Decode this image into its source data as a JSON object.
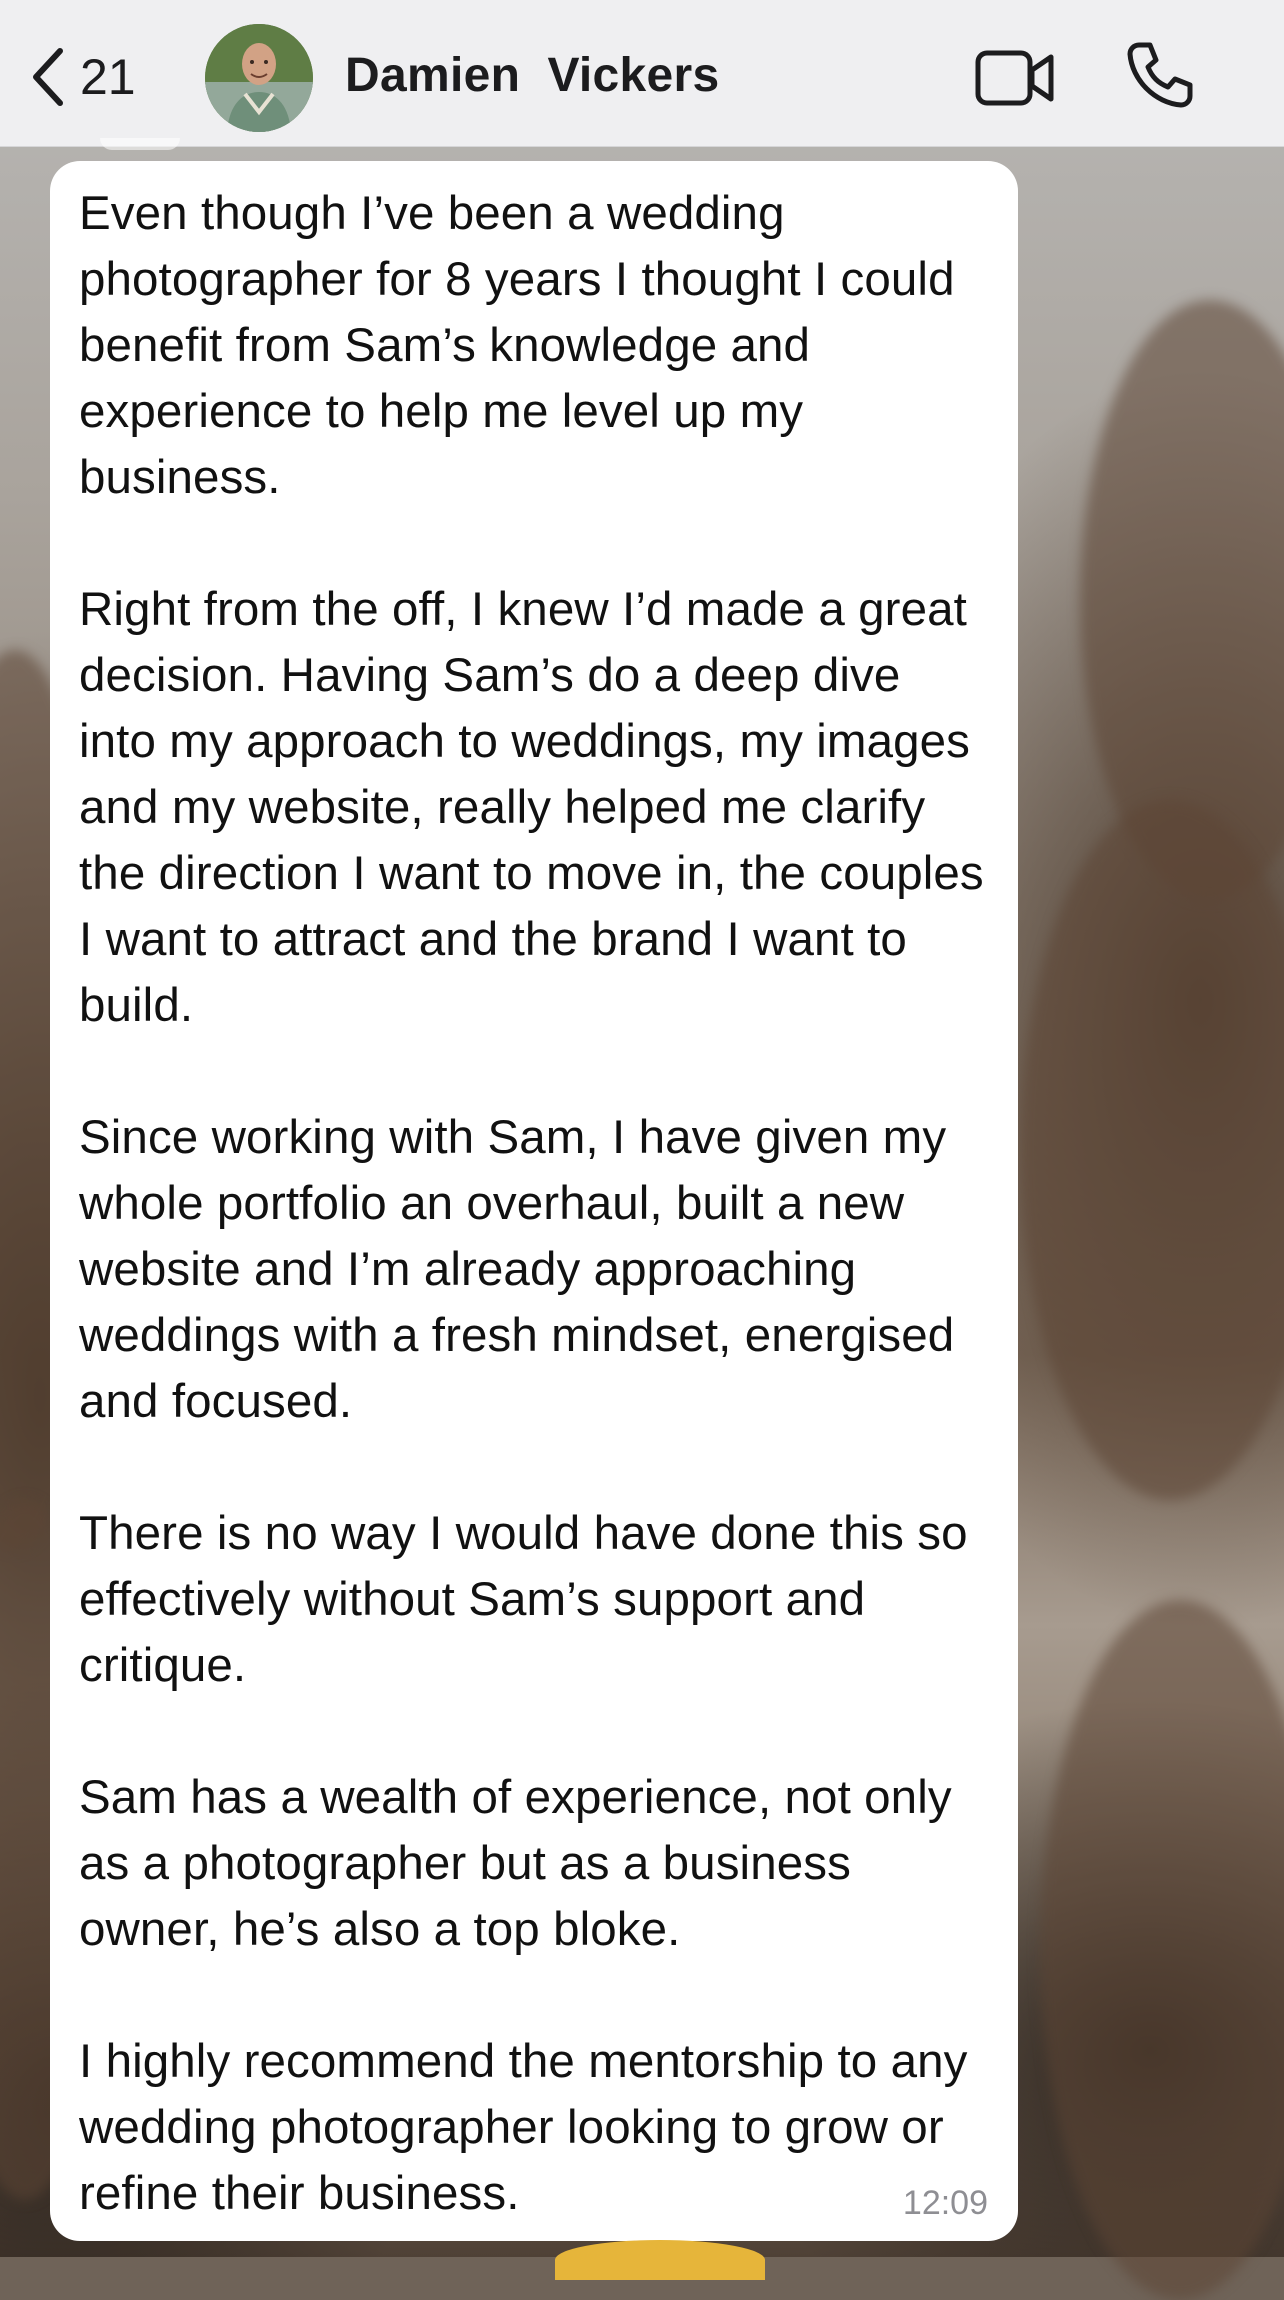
{
  "header": {
    "back_count": "21",
    "contact_name": "Damien  Vickers",
    "icons": {
      "back": "chevron-left-icon",
      "video": "video-camera-icon",
      "call": "phone-icon"
    }
  },
  "message": {
    "paragraphs": [
      "Even though I’ve been a wedding photographer for 8 years I thought I could benefit from Sam’s knowledge and experience to help me level up my business.",
      "Right from the off, I knew I’d made a great decision. Having Sam’s do a deep dive into my approach to weddings, my images and my website, really helped me clarify the direction I want to move in, the couples I want to attract and the brand I want to build.",
      "Since working with Sam, I have given my whole portfolio an overhaul, built a new website and I’m already approaching weddings with a fresh mindset, energised and focused.",
      "There is no way I would have done this so effectively without Sam’s support and critique.",
      "Sam has a wealth of experience, not only as a photographer but as a business owner, he’s also a top bloke.",
      "I highly recommend the mentorship to any wedding photographer looking to grow or refine their business."
    ],
    "time": "12:09"
  },
  "colors": {
    "header_bg": "#efeff1",
    "bubble_bg": "#ffffff",
    "text": "#111111",
    "timestamp": "#8e8e93"
  }
}
